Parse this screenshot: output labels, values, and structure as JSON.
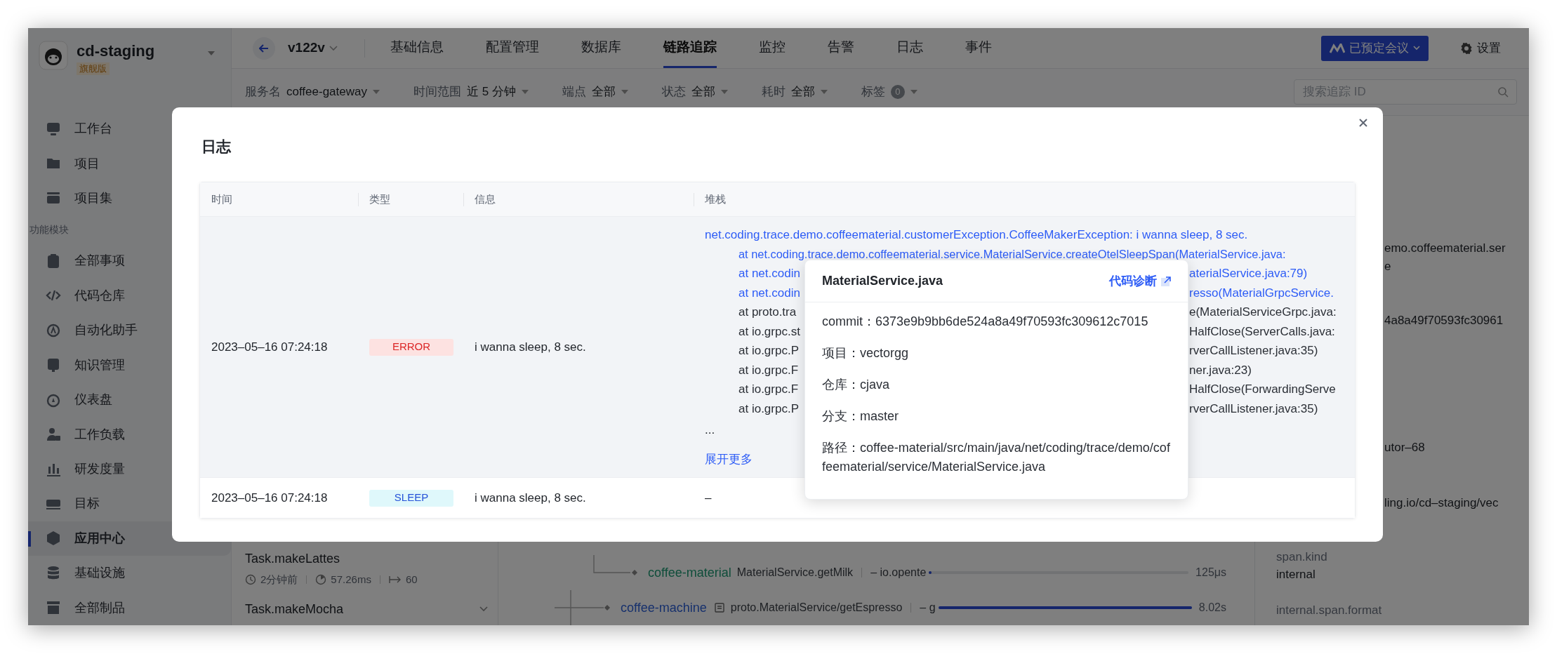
{
  "sidebar": {
    "workspace": "cd-staging",
    "edition": "旗舰版",
    "items": [
      {
        "kind": "item",
        "label": "工作台",
        "selected": false
      },
      {
        "kind": "item",
        "label": "项目",
        "selected": false
      },
      {
        "kind": "item",
        "label": "项目集",
        "selected": false
      },
      {
        "kind": "section",
        "label": "功能模块"
      },
      {
        "kind": "item",
        "label": "全部事项",
        "selected": false
      },
      {
        "kind": "item",
        "label": "代码仓库",
        "selected": false
      },
      {
        "kind": "item",
        "label": "自动化助手",
        "selected": false
      },
      {
        "kind": "item",
        "label": "知识管理",
        "selected": false
      },
      {
        "kind": "item",
        "label": "仪表盘",
        "selected": false
      },
      {
        "kind": "item",
        "label": "工作负载",
        "selected": false
      },
      {
        "kind": "item",
        "label": "研发度量",
        "selected": false
      },
      {
        "kind": "item",
        "label": "目标",
        "selected": false
      },
      {
        "kind": "item",
        "label": "应用中心",
        "selected": true
      },
      {
        "kind": "item",
        "label": "基础设施",
        "selected": false
      },
      {
        "kind": "item",
        "label": "全部制品",
        "selected": false
      }
    ]
  },
  "topbar": {
    "version": "v122v",
    "tabs": [
      {
        "label": "基础信息",
        "selected": false
      },
      {
        "label": "配置管理",
        "selected": false
      },
      {
        "label": "数据库",
        "selected": false
      },
      {
        "label": "链路追踪",
        "selected": true
      },
      {
        "label": "监控",
        "selected": false
      },
      {
        "label": "告警",
        "selected": false
      },
      {
        "label": "日志",
        "selected": false
      },
      {
        "label": "事件",
        "selected": false
      }
    ],
    "meeting_button": "已预定会议",
    "settings": "设置"
  },
  "filters": [
    {
      "kind": "select",
      "label": "服务名",
      "value": "coffee-gateway"
    },
    {
      "kind": "select",
      "label": "时间范围",
      "value": "近 5 分钟"
    },
    {
      "kind": "select",
      "label": "端点",
      "value": "全部"
    },
    {
      "kind": "select",
      "label": "状态",
      "value": "全部"
    },
    {
      "kind": "select",
      "label": "耗时",
      "value": "全部"
    },
    {
      "kind": "count",
      "label": "标签",
      "value": "0"
    }
  ],
  "search": {
    "placeholder": "搜索追踪 ID"
  },
  "trace_list": [
    {
      "name": "Task.makeLattes",
      "age": "2分钟前",
      "duration": "57.26ms",
      "spans": "60"
    },
    {
      "name": "Task.makeMocha"
    }
  ],
  "spans": [
    {
      "kind": "plain",
      "service": "coffee-material",
      "operation": "MaterialService.getMilk",
      "detail": "– io.opente",
      "duration": "125μs",
      "level": 0.01
    },
    {
      "kind": "annotated",
      "service": "coffee-machine",
      "operation": "proto.MaterialService/getEspresso",
      "detail": "– g",
      "duration": "8.02s",
      "level": 1.0
    }
  ],
  "detail_panel": [
    {
      "kind": "value",
      "text": "emo.coffeematerial.ser"
    },
    {
      "kind": "value",
      "text": "e"
    },
    {
      "kind": "value",
      "text": "4a8a49f70593fc30961"
    },
    {
      "kind": "value",
      "text": "utor–68"
    },
    {
      "kind": "value",
      "text": "ling.io/cd–staging/vec"
    },
    {
      "kind": "key",
      "text": "span.kind"
    },
    {
      "kind": "value",
      "text": "internal"
    },
    {
      "kind": "key",
      "text": "internal.span.format"
    }
  ],
  "log_dialog": {
    "title": "日志",
    "columns": [
      "时间",
      "类型",
      "信息",
      "堆栈"
    ],
    "rows": [
      {
        "hovered": true,
        "time": "2023–05–16 07:24:18",
        "type": {
          "kind": "error",
          "label": "ERROR"
        },
        "message": "i wanna sleep, 8 sec.",
        "stack": {
          "exception": "net.coding.trace.demo.coffeematerial.customerException.CoffeeMakerException: i wanna sleep, 8 sec.",
          "frames": [
            {
              "linked": true,
              "parts": [
                "at net.coding.trace.demo.coffeematerial.service.MaterialService.createOtelSleepSpan(MaterialService.java:"
              ]
            },
            {
              "linked": true,
              "parts": [
                "at net.codin",
                "aterialService.java:79)"
              ]
            },
            {
              "linked": true,
              "parts": [
                "at net.codin",
                "resso(MaterialGrpcService."
              ]
            },
            {
              "linked": false,
              "parts": [
                "at proto.tra",
                "e(MaterialServiceGrpc.java:"
              ]
            },
            {
              "linked": false,
              "parts": [
                "at io.grpc.st",
                "HalfClose(ServerCalls.java:"
              ]
            },
            {
              "linked": false,
              "parts": [
                "at io.grpc.P",
                "rverCallListener.java:35)"
              ]
            },
            {
              "linked": false,
              "parts": [
                "at io.grpc.F",
                "ner.java:23)"
              ]
            },
            {
              "linked": false,
              "parts": [
                "at io.grpc.F",
                "HalfClose(ForwardingServe"
              ]
            },
            {
              "linked": false,
              "parts": [
                "at io.grpc.P",
                "rverCallListener.java:35)"
              ]
            }
          ],
          "ellipsis": "...",
          "expand": "展开更多"
        }
      },
      {
        "hovered": false,
        "time": "2023–05–16 07:24:18",
        "type": {
          "kind": "sleep",
          "label": "SLEEP"
        },
        "message": "i wanna sleep, 8 sec.",
        "stack": {
          "text": "–"
        }
      }
    ]
  },
  "source_popup": {
    "title": "MaterialService.java",
    "link": "代码诊断",
    "fields": [
      "commit：6373e9b9bb6de524a8a49f70593fc309612c7015",
      "项目：vectorgg",
      "仓库：cjava",
      "分支：master",
      "路径：coffee-material/src/main/java/net/coding/trace/demo/coffeematerial/service/MaterialService.java"
    ]
  }
}
